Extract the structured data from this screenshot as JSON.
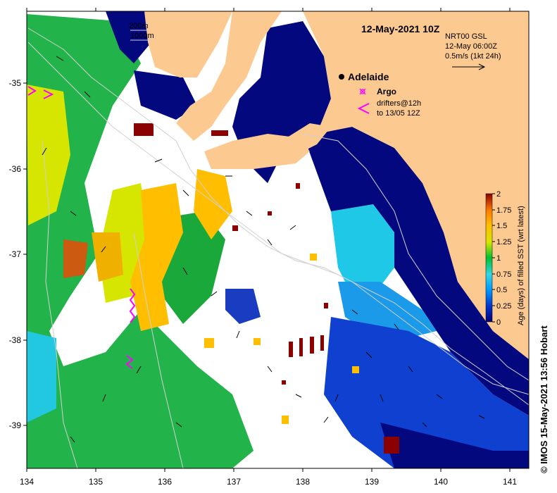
{
  "title": "12-May-2021 10Z",
  "depth_labels": [
    "200m",
    "1000m"
  ],
  "product": "NRT00 GSL",
  "current_time": "12-May 06:00Z",
  "vector_scale": "0.5m/s (1kt 24h)",
  "city": "Adelaide",
  "legend": {
    "argo": "Argo",
    "drifters_line1": "drifters@12h",
    "drifters_line2": "to 13/05 12Z"
  },
  "colorbar": {
    "label": "Age (days) of filled SST (wrt latest)",
    "ticks": [
      "0",
      "0.25",
      "0.5",
      "0.75",
      "1",
      "1.25",
      "1.5",
      "1.75",
      "2"
    ],
    "colors": [
      "#00007a",
      "#0033cc",
      "#0099ff",
      "#33d6e6",
      "#00c030",
      "#d6e600",
      "#ffbf00",
      "#ff7a00",
      "#c83200",
      "#8b0000"
    ]
  },
  "lon_ticks": [
    "134",
    "135",
    "136",
    "137",
    "138",
    "139",
    "140",
    "141"
  ],
  "lat_ticks": [
    "-35",
    "-36",
    "-37",
    "-38",
    "-39"
  ],
  "credit": "© IMOS 15-May-2021 13:56 Hobart",
  "map_colors": {
    "land": "#fcc990",
    "ocean_fresh": "#04087e",
    "no_data": "#ffffff"
  }
}
